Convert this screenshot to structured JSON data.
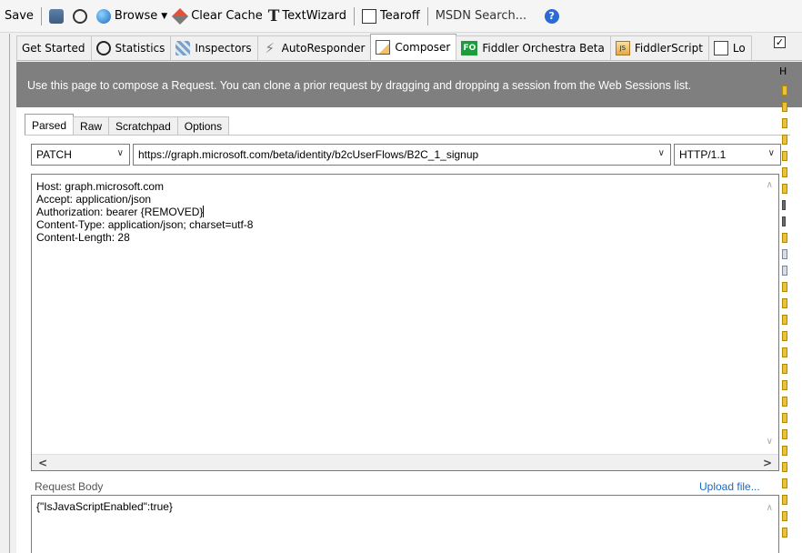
{
  "toolbar": {
    "save": "Save",
    "browse": "Browse",
    "clear_cache": "Clear Cache",
    "textwizard": "TextWizard",
    "tearoff": "Tearoff",
    "search_placeholder": "MSDN Search..."
  },
  "main_tabs": [
    {
      "label": "Get Started"
    },
    {
      "label": "Statistics"
    },
    {
      "label": "Inspectors"
    },
    {
      "label": "AutoResponder"
    },
    {
      "label": "Composer",
      "active": true
    },
    {
      "label": "Fiddler Orchestra Beta",
      "icon_text": "FO"
    },
    {
      "label": "FiddlerScript",
      "icon_text": "JS"
    },
    {
      "label": "Lo"
    }
  ],
  "info_text": "Use this page to compose a Request. You can clone a prior request by dragging and dropping a session from the Web Sessions list.",
  "composer": {
    "tabs": [
      {
        "label": "Parsed",
        "active": true
      },
      {
        "label": "Raw"
      },
      {
        "label": "Scratchpad"
      },
      {
        "label": "Options"
      }
    ],
    "method": "PATCH",
    "url": "https://graph.microsoft.com/beta/identity/b2cUserFlows/B2C_1_signup",
    "protocol": "HTTP/1.1",
    "headers": [
      "Host: graph.microsoft.com",
      "Accept: application/json",
      "Authorization: bearer {REMOVED}",
      "Content-Type: application/json; charset=utf-8",
      "Content-Length: 28"
    ],
    "request_body_label": "Request Body",
    "upload_file": "Upload file...",
    "body": "{\"IsJavaScriptEnabled\":true}"
  },
  "right_panel": {
    "header_letter": "H"
  },
  "colors": {
    "info_bar": "#7f7f7f",
    "link": "#1769c9"
  }
}
